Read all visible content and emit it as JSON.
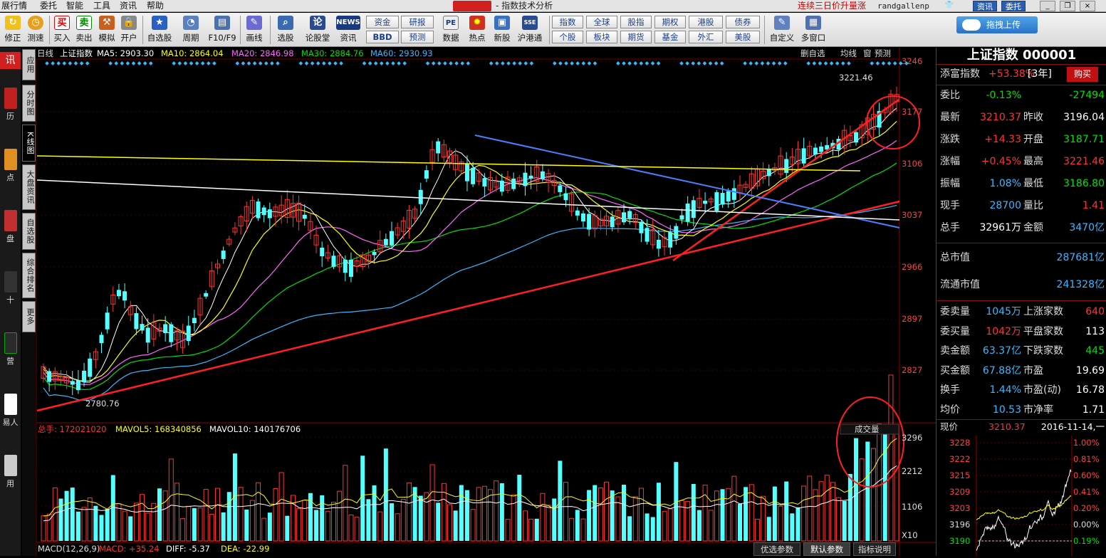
{
  "menu": {
    "items": [
      "展行情",
      "委托",
      "智能",
      "工具",
      "资讯",
      "帮助"
    ],
    "app_title": "- 指数技术分析",
    "promo": "连续三日价升量涨",
    "user": "randgallenp",
    "btn_news": "资讯",
    "btn_trade": "委托"
  },
  "toolbar": {
    "buttons": [
      {
        "label": "修正",
        "icon": "refresh-icon"
      },
      {
        "label": "测速",
        "icon": "clock-icon"
      },
      {
        "label": "买入",
        "icon": "buy-icon",
        "glyph": "买"
      },
      {
        "label": "卖出",
        "icon": "sell-icon",
        "glyph": "卖"
      },
      {
        "label": "模拟",
        "icon": "hammer-icon"
      },
      {
        "label": "开户",
        "icon": "lock-icon"
      },
      {
        "label": "自选股",
        "icon": "star-icon"
      },
      {
        "label": "周期",
        "icon": "period-icon"
      },
      {
        "label": "F10/F9",
        "icon": "f10-icon"
      },
      {
        "label": "画线",
        "icon": "pen-icon"
      },
      {
        "label": "选股",
        "icon": "select-icon"
      },
      {
        "label": "论股堂",
        "icon": "forum-icon",
        "glyph": "论"
      },
      {
        "label": "资讯",
        "icon": "news-icon",
        "glyph": "NEWS"
      },
      {
        "label": "数据",
        "icon": "pe-icon",
        "glyph": "PE"
      },
      {
        "label": "热点",
        "icon": "fire-icon"
      },
      {
        "label": "新股",
        "icon": "ipo-icon"
      },
      {
        "label": "沪港通",
        "icon": "hk-connect-icon"
      },
      {
        "label": "自定义",
        "icon": "customize-icon"
      },
      {
        "label": "多窗口",
        "icon": "multi-window-icon"
      }
    ],
    "small": {
      "zijin": "资金",
      "yanbao": "研报",
      "bbd": "BBD",
      "yuce": "预测",
      "grid": [
        "指数",
        "全球",
        "股指",
        "期权",
        "港股",
        "债券",
        "个股",
        "板块",
        "期货",
        "基金",
        "外汇",
        "美股"
      ]
    },
    "upload": "拖拽上传"
  },
  "left_strip": [
    "讯",
    "历",
    "点",
    "盘",
    "十",
    "营",
    "易人",
    "用"
  ],
  "vtabs": [
    "应用",
    "分时图",
    "K线图",
    "大盘资讯",
    "自选股",
    "综合排名",
    "更多"
  ],
  "chart_head": {
    "period": "日线",
    "name": "上证指数",
    "ma5": "MA5: 2903.30",
    "ma10": "MA10: 2864.04",
    "ma20": "MA20: 2846.98",
    "ma30": "MA30: 2884.76",
    "ma60": "MA60: 2930.93",
    "right_btns": [
      "删自选",
      "均线",
      "窗",
      "预测"
    ]
  },
  "price_axis": [
    "3246",
    "3177",
    "3106",
    "3037",
    "2966",
    "2897",
    "2827"
  ],
  "annotations": {
    "high": "3221.46",
    "low": "2780.76"
  },
  "vol_head": {
    "total": "总手: 172021020",
    "mavol5": "MAVOL5: 168340856",
    "mavol10": "MAVOL10: 140176706",
    "vol_btn": "成交量"
  },
  "vol_axis": [
    "3296",
    "2212",
    "1106",
    "X10"
  ],
  "macd_head": {
    "macd": "MACD(12,26,9)",
    "value": "MACD: +35.24",
    "diff": "DIFF: -5.37",
    "dea": "DEA: -22.99"
  },
  "bottom_tabs": [
    "优选参数",
    "默认参数",
    "指标说明"
  ],
  "right_panel": {
    "title": "上证指数 000001",
    "tianfu": {
      "label": "添富指数",
      "value": "+53.38%",
      "period": "[3年]",
      "buy": "购买"
    },
    "rows": [
      {
        "k": "委比",
        "v": "-0.13%",
        "vc": "green",
        "k2": "",
        "v2": "-27494",
        "v2c": "green"
      },
      {
        "k": "最新",
        "v": "3210.37",
        "vc": "red",
        "k2": "昨收",
        "v2": "3196.04",
        "v2c": "white"
      },
      {
        "k": "涨跌",
        "v": "+14.33",
        "vc": "red",
        "k2": "开盘",
        "v2": "3187.71",
        "v2c": "green"
      },
      {
        "k": "涨幅",
        "v": "+0.45%",
        "vc": "red",
        "k2": "最高",
        "v2": "3221.46",
        "v2c": "red"
      },
      {
        "k": "振幅",
        "v": "1.08%",
        "vc": "cyan",
        "k2": "最低",
        "v2": "3186.80",
        "v2c": "green"
      },
      {
        "k": "现手",
        "v": "28700",
        "vc": "cyan",
        "k2": "量比",
        "v2": "1.41",
        "v2c": "red"
      },
      {
        "k": "总手",
        "v": "32961万",
        "vc": "white",
        "k2": "金额",
        "v2": "3470亿",
        "v2c": "cyan"
      }
    ],
    "cap": [
      {
        "k": "总市值",
        "v": "287681亿"
      },
      {
        "k": "流通市值",
        "v": "241328亿"
      }
    ],
    "rows2": [
      {
        "k": "委卖量",
        "v": "1045万",
        "vc": "cyan",
        "k2": "上涨家数",
        "v2": "640",
        "v2c": "red"
      },
      {
        "k": "委买量",
        "v": "1042万",
        "vc": "red",
        "k2": "平盘家数",
        "v2": "113",
        "v2c": "white"
      },
      {
        "k": "卖金额",
        "v": "63.37亿",
        "vc": "cyan",
        "k2": "下跌家数",
        "v2": "445",
        "v2c": "green"
      },
      {
        "k": "买金额",
        "v": "67.88亿",
        "vc": "cyan",
        "k2": "市盈",
        "v2": "19.69",
        "v2c": "white"
      },
      {
        "k": "换手",
        "v": "1.44%",
        "vc": "cyan",
        "k2": "市盈(动)",
        "v2": "16.78",
        "v2c": "white"
      },
      {
        "k": "均价",
        "v": "10.53",
        "vc": "cyan",
        "k2": "市净率",
        "v2": "1.71",
        "v2c": "white"
      }
    ],
    "mini": {
      "label": "现价",
      "price": "3210.37",
      "date": "2016-11-14,一",
      "left_axis": [
        "3228",
        "3222",
        "3215",
        "3209",
        "3203",
        "3196",
        "3190"
      ],
      "right_axis": [
        "1.00%",
        "0.81%",
        "0.60%",
        "0.41%",
        "0.20%",
        "0.00%",
        "0.19%"
      ]
    }
  },
  "colors": {
    "up": "#ff3333",
    "down": "#54ffff",
    "ma5": "#ffffff",
    "ma10": "#ffff00",
    "ma20": "#ff66ff",
    "ma30": "#00e000",
    "ma60": "#3ab8ff",
    "trend_red": "#ff2020",
    "trend_blue": "#4a7fff",
    "trend_yellow": "#ffff00",
    "trend_white": "#ffffff"
  }
}
